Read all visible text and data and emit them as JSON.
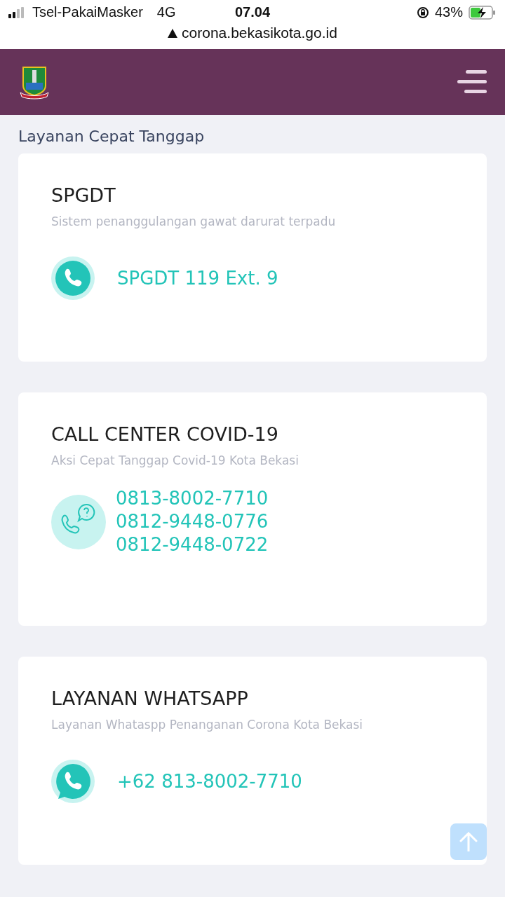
{
  "status_bar": {
    "carrier": "Tsel-PakaiMasker",
    "network": "4G",
    "time": "07.04",
    "battery": "43%"
  },
  "address_bar": {
    "url": "corona.bekasikota.go.id"
  },
  "section_title": "Layanan Cepat Tanggap",
  "cards": [
    {
      "kind": "phone",
      "title": "SPGDT",
      "subtitle": "Sistem penanggulangan gawat darurat terpadu",
      "numbers": [
        "SPGDT 119 Ext. 9"
      ]
    },
    {
      "kind": "callcenter",
      "title": "CALL CENTER COVID-19",
      "subtitle": "Aksi Cepat Tanggap Covid-19 Kota Bekasi",
      "numbers": [
        "0813-8002-7710",
        "0812-9448-0776",
        "0812-9448-0722"
      ]
    },
    {
      "kind": "whatsapp",
      "title": "LAYANAN WHATSAPP",
      "subtitle": "Layanan Whataspp Penanganan Corona Kota Bekasi",
      "numbers": [
        "+62 813-8002-7710"
      ]
    }
  ]
}
